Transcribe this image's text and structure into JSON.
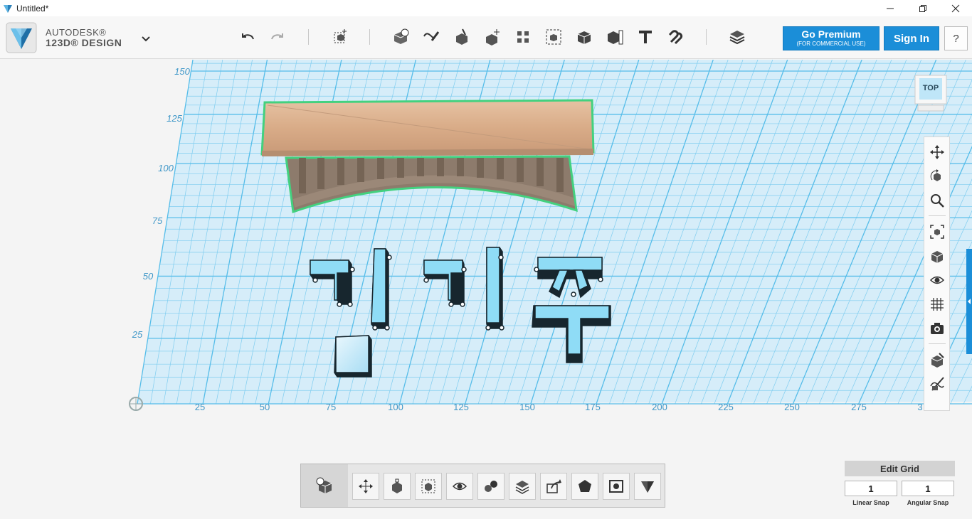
{
  "window": {
    "title": "Untitled*"
  },
  "brand": {
    "line1": "AUTODESK®",
    "line2": "123D® DESIGN"
  },
  "toolbar": {
    "premium_label": "Go Premium",
    "premium_sub": "(FOR COMMERCIAL USE)",
    "signin_label": "Sign In",
    "help_label": "?"
  },
  "viewcube": {
    "label": "TOP"
  },
  "axes": {
    "x_ticks": [
      "25",
      "50",
      "75",
      "100",
      "125",
      "150",
      "175",
      "200",
      "225",
      "250",
      "275",
      "3"
    ],
    "y_ticks": [
      "150",
      "125",
      "100",
      "75",
      "50",
      "25"
    ]
  },
  "grid": {
    "edit_label": "Edit Grid",
    "linear_snap": "1",
    "angular_snap": "1",
    "linear_label": "Linear Snap",
    "angular_label": "Angular Snap"
  },
  "colors": {
    "accent": "#1b8ed8",
    "grid_line": "#6cc3ee",
    "grid_bg": "#d9eef9",
    "selection": "#43d17f",
    "wood": "#dcb393"
  }
}
